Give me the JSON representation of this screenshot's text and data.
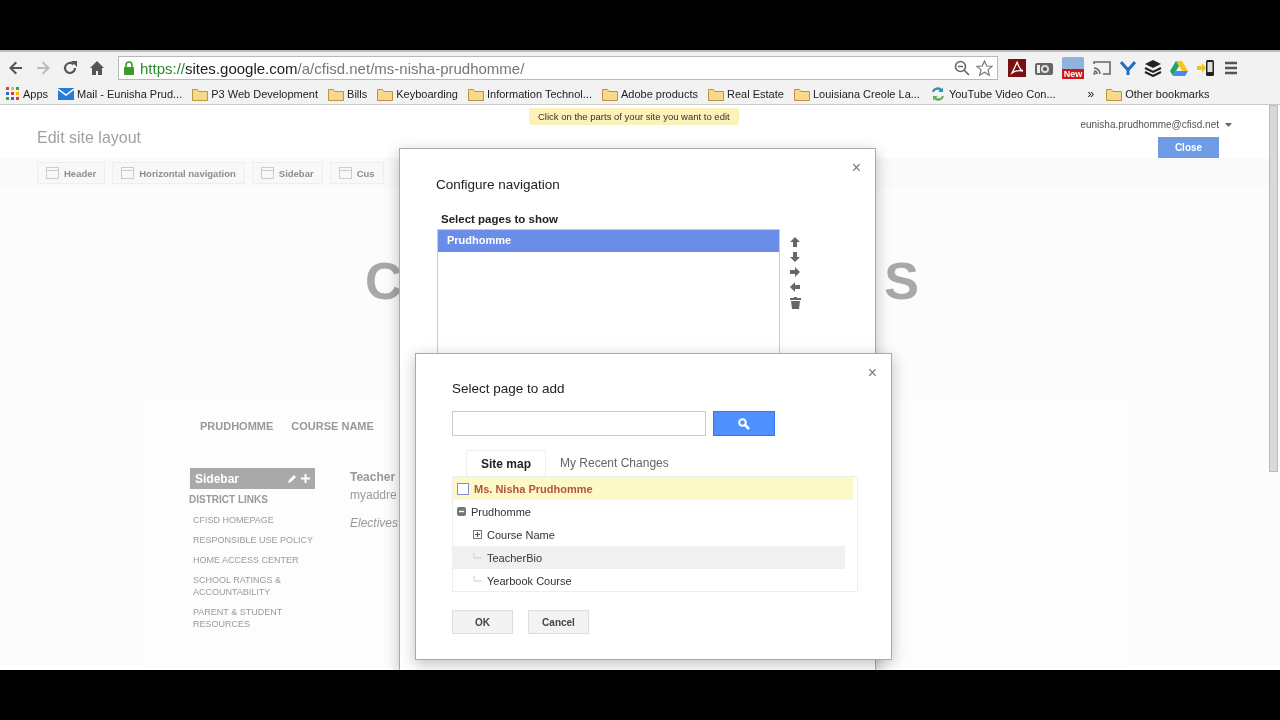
{
  "browser": {
    "url": {
      "scheme": "https://",
      "host": "sites.google.com",
      "path": "/a/cfisd.net/ms-nisha-prudhomme/"
    },
    "extension_badge": "New",
    "bookmarks": [
      {
        "label": "Apps",
        "kind": "apps"
      },
      {
        "label": "Mail - Eunisha Prud...",
        "kind": "mail"
      },
      {
        "label": "P3 Web Development",
        "kind": "folder"
      },
      {
        "label": "Bills",
        "kind": "folder"
      },
      {
        "label": "Keyboarding",
        "kind": "folder"
      },
      {
        "label": "Information Technol...",
        "kind": "folder"
      },
      {
        "label": "Adobe products",
        "kind": "folder"
      },
      {
        "label": "Real Estate",
        "kind": "folder"
      },
      {
        "label": "Louisiana Creole La...",
        "kind": "folder"
      },
      {
        "label": "YouTube Video Con...",
        "kind": "link"
      }
    ],
    "overflow": "»",
    "other_bookmarks": "Other bookmarks"
  },
  "tooltip": "Click on the parts of your site you want to edit",
  "editor": {
    "title": "Edit site layout",
    "account": "eunisha.prudhomme@cfisd.net",
    "close_button": "Close",
    "layout_tools": [
      "Header",
      "Horizontal navigation",
      "Sidebar",
      "Cus"
    ]
  },
  "site": {
    "logo_left": "C",
    "logo_right": "S",
    "nav": [
      "PRUDHOMME",
      "COURSE NAME"
    ],
    "sidebar": {
      "title": "Sidebar",
      "heading": "DISTRICT LINKS",
      "links": [
        "CFISD HOMEPAGE",
        "RESPONSIBLE USE POLICY",
        "HOME ACCESS CENTER",
        "SCHOOL RATINGS & ACCOUNTABILITY",
        "PARENT & STUDENT RESOURCES"
      ]
    },
    "content": [
      {
        "kind": "heading",
        "text": "Teacher"
      },
      {
        "kind": "text",
        "text": "myaddre"
      },
      {
        "kind": "note",
        "text": "Electives"
      }
    ]
  },
  "configure_dialog": {
    "title": "Configure navigation",
    "close": "×",
    "list_label": "Select pages to show",
    "pages": [
      {
        "label": "Prudhomme",
        "selected": true
      }
    ]
  },
  "add_dialog": {
    "title": "Select page to add",
    "close": "×",
    "tabs": [
      {
        "label": "Site map",
        "selected": true
      },
      {
        "label": "My Recent Changes",
        "selected": false
      }
    ],
    "tree": [
      {
        "label": "Ms. Nisha Prudhomme",
        "kind": "site",
        "selected": true,
        "hovered": false
      },
      {
        "label": "Prudhomme",
        "kind": "page",
        "selected": false,
        "hovered": false,
        "expanded": true,
        "children": [
          {
            "label": "Course Name",
            "kind": "page",
            "selected": false,
            "hovered": false,
            "expanded": false
          },
          {
            "label": "TeacherBio",
            "kind": "page",
            "selected": false,
            "hovered": true
          },
          {
            "label": "Yearbook Course",
            "kind": "page",
            "selected": false,
            "hovered": false
          }
        ]
      }
    ],
    "buttons": [
      "OK",
      "Cancel"
    ]
  }
}
